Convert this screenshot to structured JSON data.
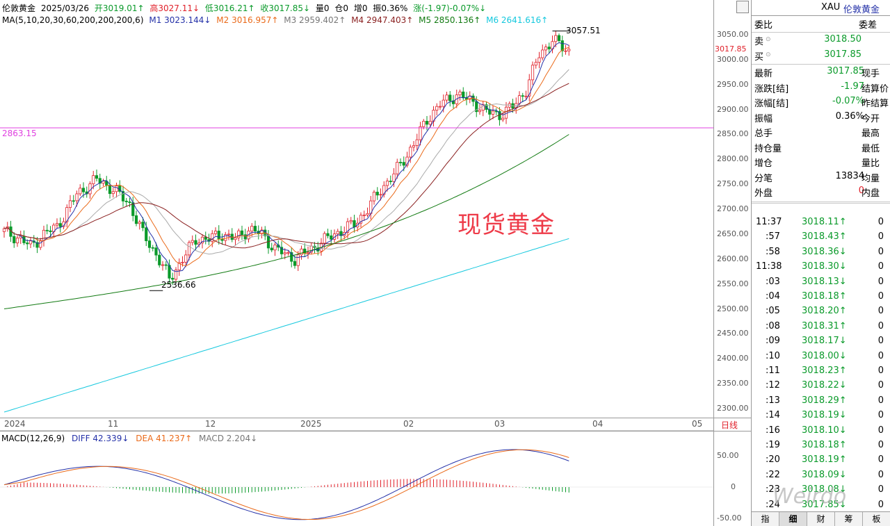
{
  "info_line1": {
    "name": "伦敦黄金",
    "date": "2025/03/26",
    "open": "开3019.01↑",
    "high": "高3027.11↓",
    "low": "低3016.21↑",
    "close": "收3017.85↓",
    "volume": "量0",
    "position": "仓0",
    "increase": "增0",
    "amplitude": "振0.36%",
    "change": "涨(-1.97)-0.07%↓"
  },
  "info_line2": {
    "ma_label": "MA(5,10,20,30,60,200,200,200,6)",
    "m1": "M1 3023.144↓",
    "m2": "M2 3016.957↑",
    "m3": "M3 2959.402↑",
    "m4": "M4 2947.403↑",
    "m5": "M5 2850.136↑",
    "m6": "M6 2641.616↑"
  },
  "colors": {
    "up": "#e0202a",
    "down": "#0a9a2a",
    "m1": "#2431a8",
    "m2": "#ea6a1a",
    "m3": "#aaaaaa",
    "m4": "#8a1f1f",
    "m5": "#117a11",
    "m6": "#14c8de",
    "level": "#e040e0"
  },
  "watermark_title": "现货黄金",
  "annotations": {
    "high": "3057.51",
    "low": "2536.66",
    "level": "2863.15"
  },
  "current_price_tag": "3017.85",
  "y_ticks": [
    "3050.00",
    "3000.00",
    "2950.00",
    "2900.00",
    "2850.00",
    "2800.00",
    "2750.00",
    "2700.00",
    "2650.00",
    "2600.00",
    "2550.00",
    "2500.00",
    "2450.00",
    "2400.00",
    "2350.00",
    "2300.00"
  ],
  "x_labels": [
    "2024",
    "11",
    "12",
    "2025",
    "02",
    "03",
    "04",
    "05"
  ],
  "period_label": "日线",
  "macd": {
    "label": "MACD(12,26,9)",
    "diff": "DIFF 42.339↓",
    "dea": "DEA 41.237↑",
    "macd": "MACD 2.204↓",
    "y_ticks": [
      "50.00",
      "0",
      "-50.00"
    ]
  },
  "panel": {
    "symbol": "XAU",
    "name": "伦敦黄金",
    "weibi": "委比",
    "weicha": "委差",
    "sell_label": "卖",
    "sell_price": "3018.50",
    "buy_label": "买",
    "buy_price": "3017.85",
    "rows": [
      {
        "label": "最新",
        "value": "3017.85",
        "right": "现手",
        "color": "#0a9a2a"
      },
      {
        "label": "涨跌[结]",
        "value": "-1.97",
        "right": "结算价",
        "color": "#0a9a2a"
      },
      {
        "label": "涨幅[结]",
        "value": "-0.07%",
        "right": "昨结算",
        "color": "#0a9a2a"
      },
      {
        "label": "振幅",
        "value": "0.36%",
        "right": "今开",
        "color": "#000000"
      },
      {
        "label": "总手",
        "value": "",
        "right": "最高",
        "color": "#000000"
      },
      {
        "label": "持仓量",
        "value": "",
        "right": "最低",
        "color": "#000000"
      },
      {
        "label": "增仓",
        "value": "",
        "right": "量比",
        "color": "#000000"
      },
      {
        "label": "分笔",
        "value": "13834",
        "right": "均量",
        "color": "#000000"
      },
      {
        "label": "外盘",
        "value": "0",
        "right": "内盘",
        "color": "#e0202a"
      }
    ],
    "ticks": [
      {
        "time": "11:37",
        "price": "3018.11↑",
        "vol": "0"
      },
      {
        "time": ":57",
        "price": "3018.43↑",
        "vol": "0"
      },
      {
        "time": ":58",
        "price": "3018.36↓",
        "vol": "0"
      },
      {
        "time": "11:38",
        "price": "3018.30↓",
        "vol": "0"
      },
      {
        "time": ":03",
        "price": "3018.13↓",
        "vol": "0"
      },
      {
        "time": ":04",
        "price": "3018.18↑",
        "vol": "0"
      },
      {
        "time": ":05",
        "price": "3018.20↑",
        "vol": "0"
      },
      {
        "time": ":08",
        "price": "3018.31↑",
        "vol": "0"
      },
      {
        "time": ":09",
        "price": "3018.17↓",
        "vol": "0"
      },
      {
        "time": ":10",
        "price": "3018.00↓",
        "vol": "0"
      },
      {
        "time": ":11",
        "price": "3018.23↑",
        "vol": "0"
      },
      {
        "time": ":12",
        "price": "3018.22↓",
        "vol": "0"
      },
      {
        "time": ":13",
        "price": "3018.29↑",
        "vol": "0"
      },
      {
        "time": ":14",
        "price": "3018.19↓",
        "vol": "0"
      },
      {
        "time": ":16",
        "price": "3018.10↓",
        "vol": "0"
      },
      {
        "time": ":19",
        "price": "3018.18↑",
        "vol": "0"
      },
      {
        "time": ":20",
        "price": "3018.19↑",
        "vol": "0"
      },
      {
        "time": ":22",
        "price": "3018.09↓",
        "vol": "0"
      },
      {
        "time": ":23",
        "price": "3018.08↓",
        "vol": "0"
      },
      {
        "time": ":24",
        "price": "3017.85↓",
        "vol": "0"
      }
    ],
    "tabs": [
      "指",
      "细",
      "财",
      "筹",
      "板"
    ],
    "active_tab": "细"
  },
  "watermark_logo": "Weirdo"
}
